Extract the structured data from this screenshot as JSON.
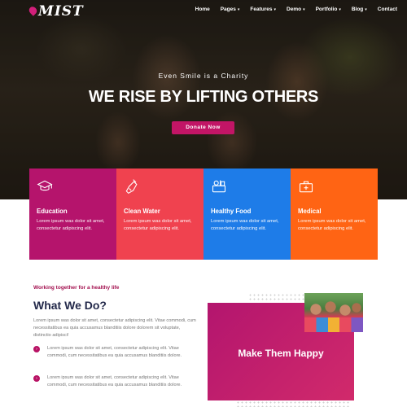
{
  "header": {
    "logo": "MIST",
    "menu": [
      {
        "label": "Home",
        "dropdown": false
      },
      {
        "label": "Pages",
        "dropdown": true
      },
      {
        "label": "Features",
        "dropdown": true
      },
      {
        "label": "Demo",
        "dropdown": true
      },
      {
        "label": "Portfolio",
        "dropdown": true
      },
      {
        "label": "Blog",
        "dropdown": true
      },
      {
        "label": "Contact",
        "dropdown": false
      }
    ]
  },
  "hero": {
    "tagline": "Even Smile is a Charity",
    "headline": "WE RISE BY LIFTING OTHERS",
    "button_label": "Donate Now"
  },
  "cards": [
    {
      "title": "Education",
      "text": "Lorem ipsum was dolor sit amet, consectetur adipiscing elit.",
      "color": "#b5146c",
      "icon": "graduation-cap-icon"
    },
    {
      "title": "Clean Water",
      "text": "Lorem ipsum was dolor sit amet, consectetur adipiscing elit.",
      "color": "#f0424f",
      "icon": "water-bottle-icon"
    },
    {
      "title": "Healthy Food",
      "text": "Lorem ipsum was dolor sit amet, consectetur adipiscing elit.",
      "color": "#1e7ce8",
      "icon": "food-basket-icon"
    },
    {
      "title": "Medical",
      "text": "Lorem ipsum was dolor sit amet, consectetur adipiscing elit.",
      "color": "#ff6414",
      "icon": "medical-kit-icon"
    }
  ],
  "what_we_do": {
    "kicker": "Working together for a healthy life",
    "title": "What We Do?",
    "intro": "Lorem ipsum was dolor sit amet, consectetur adipiscing elit. Vitae commodi, cum necessitatibus ea quia accusamus blanditiis dolore dolorem sit voluptate, distinctio adipisci!",
    "bullets": [
      "Lorem ipsum was dolor sit amet, consectetur adipiscing elit. Vitae commodi, cum necessitatibus ea quia accusamus blanditiis dolore.",
      "Lorem ipsum was dolor sit amet, consectetur adipiscing elit. Vitae commodi, cum necessitatibus ea quia accusamus blanditiis dolore."
    ]
  },
  "promo": {
    "title": "Make Them Happy"
  },
  "colors": {
    "accent": "#c21566",
    "heading": "#23294a"
  }
}
